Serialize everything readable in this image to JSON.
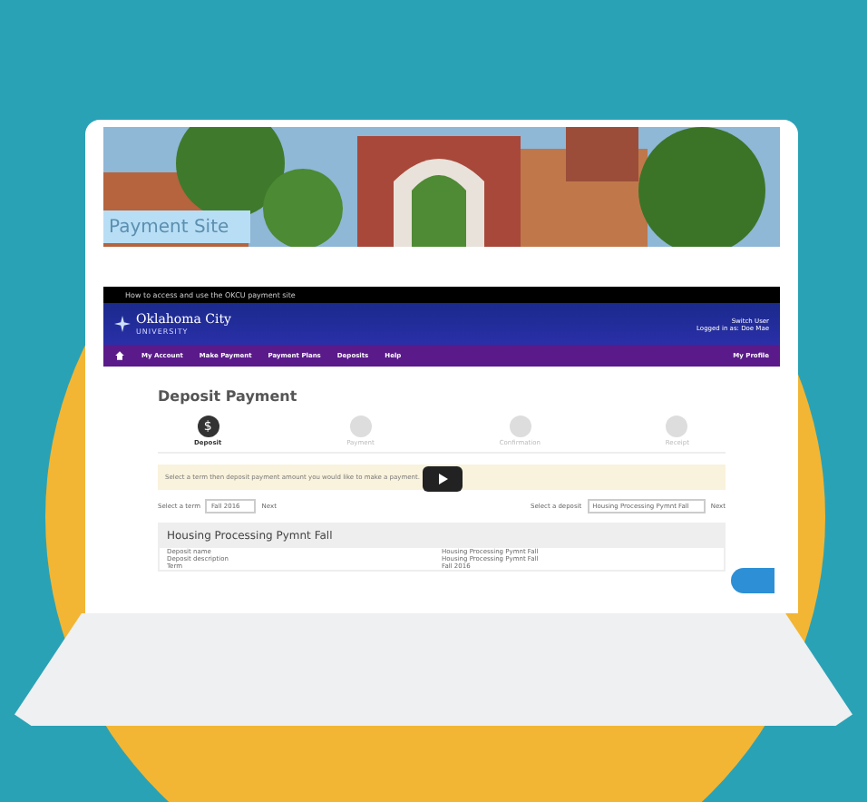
{
  "banner": {
    "title": "Payment Site"
  },
  "site_header": {
    "video_title": "How to access and use the OKCU payment site",
    "logo_name": "Oklahoma City",
    "logo_sub": "UNIVERSITY",
    "user_links": [
      "Switch User",
      "Logged in as: Doe Mae"
    ]
  },
  "nav": {
    "items": [
      {
        "label": "My Account"
      },
      {
        "label": "Make Payment"
      },
      {
        "label": "Payment Plans"
      },
      {
        "label": "Deposits"
      },
      {
        "label": "Help"
      }
    ],
    "profile": "My Profile"
  },
  "page_title": "Deposit Payment",
  "steps": [
    {
      "icon": "$",
      "label": "Deposit",
      "selected": true
    },
    {
      "label": "Payment",
      "selected": false
    },
    {
      "label": "Confirmation",
      "selected": false
    },
    {
      "label": "Receipt",
      "selected": false
    }
  ],
  "notice": "Select a term then deposit payment amount you would like to make a payment.",
  "selectors": [
    {
      "label": "Select a term",
      "value": "Fall 2016",
      "button": "Next"
    },
    {
      "label": "Select a deposit",
      "value": "Housing Processing Pymnt Fall",
      "button": "Next"
    }
  ],
  "deposit": {
    "title": "Housing Processing Pymnt Fall",
    "rows": [
      {
        "name": "Deposit name",
        "value": "Housing Processing Pymnt Fall"
      },
      {
        "name": "Deposit description",
        "value": "Housing Processing Pymnt Fall"
      },
      {
        "name": "Term",
        "value": "Fall 2016"
      }
    ]
  }
}
